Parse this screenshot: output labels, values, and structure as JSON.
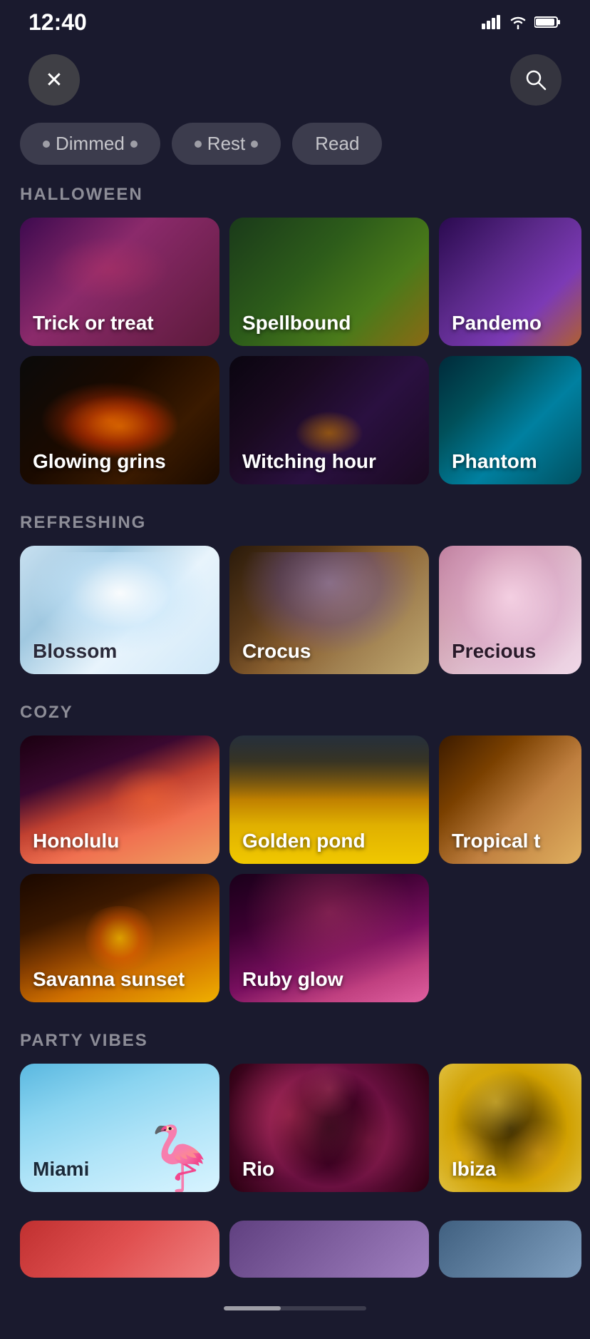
{
  "statusBar": {
    "time": "12:40",
    "signal": "▄▄▄",
    "wifi": "wifi",
    "battery": "battery"
  },
  "topBar": {
    "closeLabel": "✕",
    "searchLabel": "🔍"
  },
  "filterPills": [
    {
      "label": "Dimmed",
      "id": "dimmed"
    },
    {
      "label": "Rest",
      "id": "rest"
    },
    {
      "label": "Read",
      "id": "read"
    }
  ],
  "sections": [
    {
      "id": "halloween",
      "title": "HALLOWEEN",
      "rows": [
        [
          {
            "id": "trick-or-treat",
            "label": "Trick or treat",
            "colorClass": "halloween-1"
          },
          {
            "id": "spellbound",
            "label": "Spellbound",
            "colorClass": "halloween-2"
          },
          {
            "id": "pandemo",
            "label": "Pandemo",
            "colorClass": "halloween-3",
            "cut": true
          }
        ],
        [
          {
            "id": "glowing-grins",
            "label": "Glowing grins",
            "colorClass": "jack-o"
          },
          {
            "id": "witching-hour",
            "label": "Witching hour",
            "colorClass": "witching"
          },
          {
            "id": "phantom",
            "label": "Phantom",
            "colorClass": "phantom",
            "cut": true
          }
        ]
      ]
    },
    {
      "id": "refreshing",
      "title": "REFRESHING",
      "rows": [
        [
          {
            "id": "blossom",
            "label": "Blossom",
            "colorClass": "blossom-bg",
            "darkLabel": true
          },
          {
            "id": "crocus",
            "label": "Crocus",
            "colorClass": "crocus-bg"
          },
          {
            "id": "precious",
            "label": "Precious",
            "colorClass": "precious-bg",
            "cut": true,
            "darkLabel": true
          }
        ]
      ]
    },
    {
      "id": "cozy",
      "title": "COZY",
      "rows": [
        [
          {
            "id": "honolulu",
            "label": "Honolulu",
            "colorClass": "honolulu-bg"
          },
          {
            "id": "golden-pond",
            "label": "Golden pond",
            "colorClass": "golden-bg"
          },
          {
            "id": "tropical",
            "label": "Tropical t",
            "colorClass": "tropical-bg",
            "cut": true
          }
        ],
        [
          {
            "id": "savanna-sunset",
            "label": "Savanna sunset",
            "colorClass": "savanna-bg"
          },
          {
            "id": "ruby-glow",
            "label": "Ruby glow",
            "colorClass": "ruby-bg"
          }
        ]
      ]
    },
    {
      "id": "party-vibes",
      "title": "PARTY VIBES",
      "rows": [
        [
          {
            "id": "miami",
            "label": "Miami",
            "colorClass": "flamingo-bg",
            "darkLabel": false
          },
          {
            "id": "rio",
            "label": "Rio",
            "colorClass": "rio-bg"
          },
          {
            "id": "ibiza",
            "label": "Ibiza",
            "colorClass": "ibiza-bg",
            "cut": true
          }
        ]
      ]
    }
  ],
  "scrollIndicator": {
    "visible": true
  }
}
